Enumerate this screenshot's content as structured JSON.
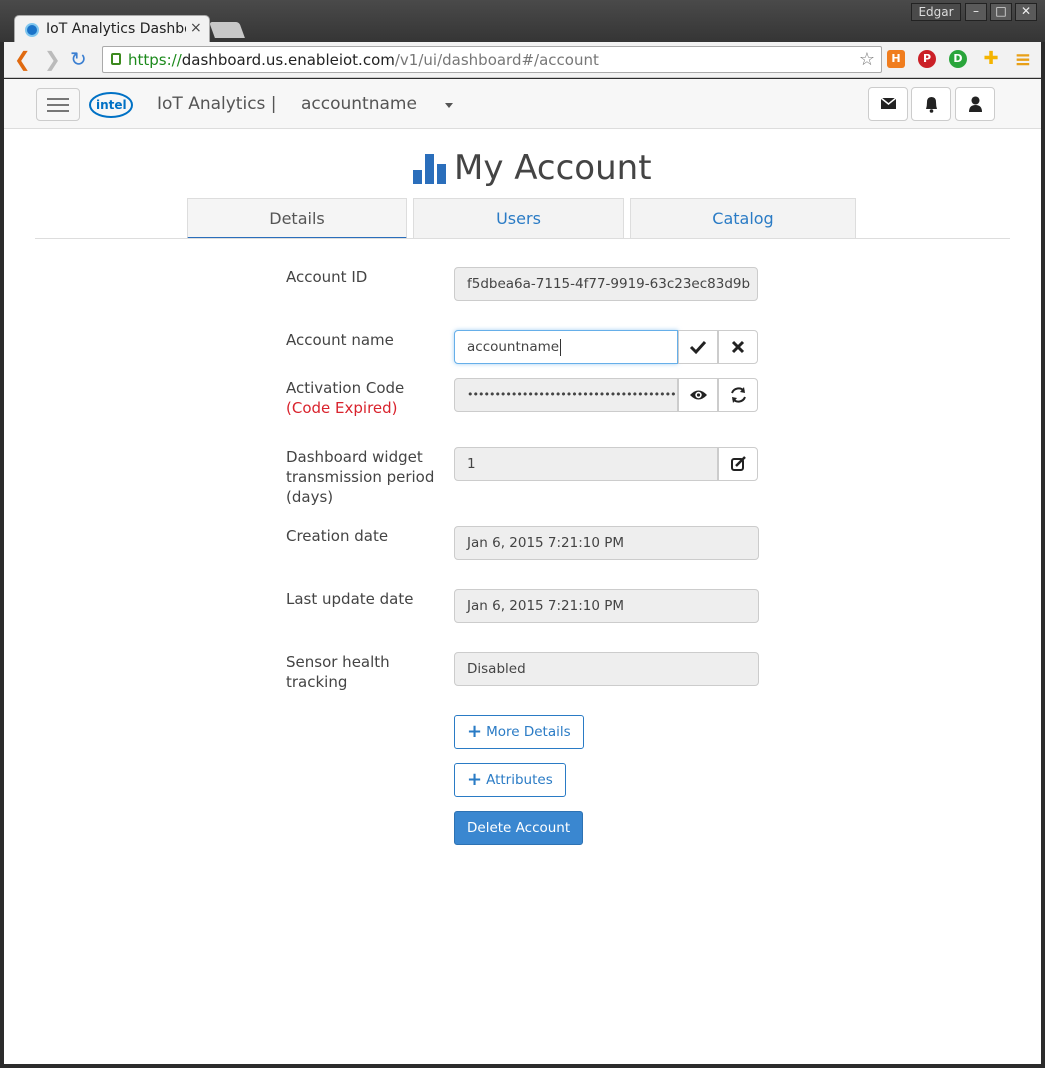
{
  "browser": {
    "tab_title": "IoT Analytics Dashbo",
    "tab_close": "×",
    "user": "Edgar",
    "url_scheme": "https://",
    "url_host": "dashboard.us.enableiot.com",
    "url_path": "/v1/ui/dashboard#/account",
    "window_buttons": [
      "–",
      "□",
      "✕"
    ],
    "extensions": [
      {
        "name": "h-extension-icon",
        "glyph": "H",
        "color": "#f07d1e"
      },
      {
        "name": "pinterest-icon",
        "glyph": "P",
        "color": "#cb2027"
      },
      {
        "name": "id-extension-icon",
        "glyph": "D",
        "color": "#2aa53b"
      },
      {
        "name": "plus-extension-icon",
        "glyph": "✚",
        "color": "#f4b400"
      },
      {
        "name": "menu-icon",
        "glyph": "≡",
        "color": "#e8a018"
      }
    ]
  },
  "appbar": {
    "brand": "IoT Analytics |",
    "account": "accountname",
    "logo_text": "intel"
  },
  "page": {
    "title": "My Account",
    "tabs": [
      {
        "label": "Details",
        "active": true
      },
      {
        "label": "Users",
        "active": false
      },
      {
        "label": "Catalog",
        "active": false
      }
    ]
  },
  "form": {
    "account_id_label": "Account ID",
    "account_id": "f5dbea6a-7115-4f77-9919-63c23ec83d9b",
    "account_name_label": "Account name",
    "account_name": "accountname",
    "activation_label": "Activation Code",
    "activation_status": "(Code Expired)",
    "activation_code": "••••••••••••••••••••••••••••••••••••••",
    "widget_label": "Dashboard widget transmission period (days)",
    "widget_period": "1",
    "creation_label": "Creation date",
    "creation_date": "Jan 6, 2015 7:21:10 PM",
    "update_label": "Last update date",
    "update_date": "Jan 6, 2015 7:21:10 PM",
    "sensor_label": "Sensor health tracking",
    "sensor_value": "Disabled"
  },
  "actions": {
    "more_details": "More Details",
    "attributes": "Attributes",
    "delete_account": "Delete Account",
    "plus": "+"
  },
  "colors": {
    "accent": "#2a7bc5",
    "danger_text": "#d9232d",
    "primary_button": "#3a87d0"
  }
}
